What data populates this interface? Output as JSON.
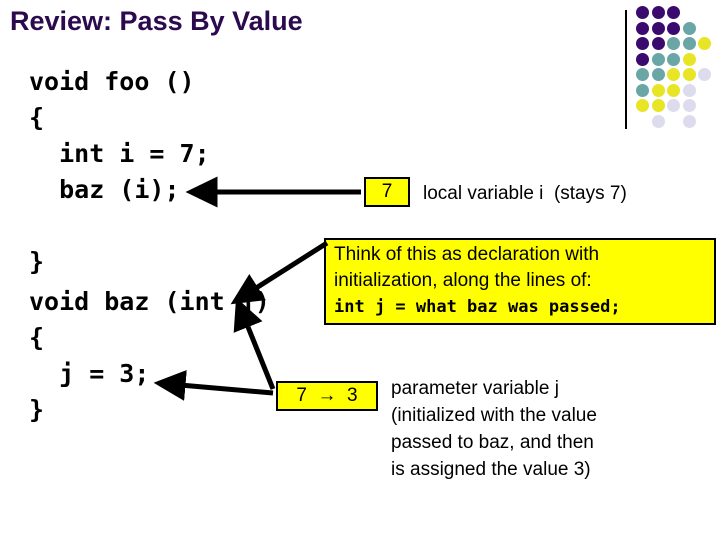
{
  "slide": {
    "title": "Review: Pass By Value",
    "background_color": "#ffffff",
    "title_color": "#2b0a4d",
    "highlight_color": "#ffff00",
    "outline_color": "#000000"
  },
  "code_blocks": {
    "foo": "void foo ()\n{\n  int i = 7;\n  baz (i);\n\n}",
    "baz": "void baz (int j)\n{\n  j = 3;\n}"
  },
  "value_boxes": {
    "i_value": "7",
    "j_value": "7  →  3"
  },
  "annotations": {
    "local_variable": "local variable i  (stays 7)",
    "parameter_variable": [
      "parameter variable j",
      "(initialized with the value",
      "passed to baz, and then",
      "is assigned the value 3)"
    ]
  },
  "callout": {
    "line1": "Think of this as declaration with",
    "line2": "initialization, along the lines of:",
    "code_line": "int j = what baz was passed;"
  },
  "dot_grid": {
    "colors": {
      "purple": "#3b0a6e",
      "teal": "#6aa6a6",
      "yellow": "#e8e526",
      "lavender": "#dcdcec"
    },
    "rows": [
      [
        "purple",
        "purple",
        "purple",
        null,
        null
      ],
      [
        "purple",
        "purple",
        "purple",
        "teal",
        null
      ],
      [
        "purple",
        "purple",
        "teal",
        "teal",
        "yellow"
      ],
      [
        "purple",
        "teal",
        "teal",
        "yellow",
        null
      ],
      [
        "teal",
        "teal",
        "yellow",
        "yellow",
        "lavender"
      ],
      [
        "teal",
        "yellow",
        "yellow",
        "lavender",
        null
      ],
      [
        "yellow",
        "yellow",
        "lavender",
        "lavender",
        null
      ],
      [
        null,
        "lavender",
        null,
        "lavender",
        null
      ]
    ]
  },
  "arrows": [
    {
      "name": "arrow-to-baz-call",
      "from": "i-value-box",
      "to": "baz-call-statement"
    },
    {
      "name": "arrow-to-param-decl",
      "from": "callout-box",
      "to": "int-j-parameter"
    },
    {
      "name": "arrow-to-param-decl-2",
      "from": "j-value-box",
      "to": "int-j-parameter"
    },
    {
      "name": "arrow-to-assignment",
      "from": "j-value-box",
      "to": "j-assignment-statement"
    }
  ]
}
